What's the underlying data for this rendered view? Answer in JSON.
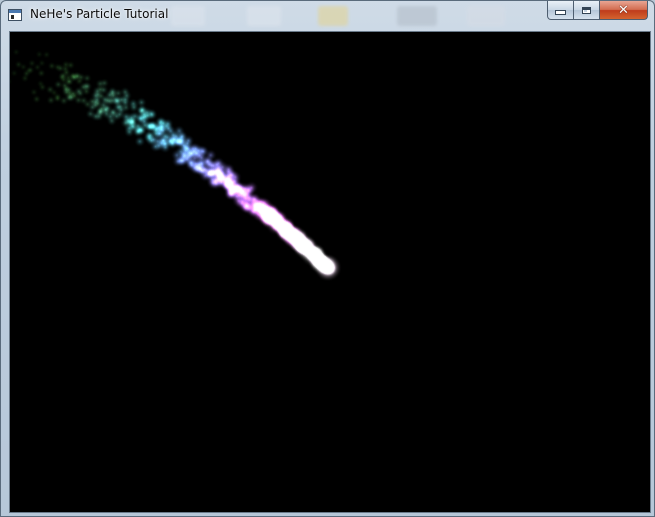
{
  "window": {
    "title": "NeHe's Particle Tutorial",
    "icon": "opengl-window-icon",
    "minimize_glyph": "minimize-icon",
    "maximize_glyph": "maximize-icon",
    "close_glyph": "✕"
  },
  "scene": {
    "background": "#000000",
    "particle_colors": [
      "#2e6b2a",
      "#4ea24a",
      "#62c4a0",
      "#5ee0e8",
      "#7f9cff",
      "#b97cf5",
      "#e86bf0",
      "#ffffff"
    ]
  }
}
